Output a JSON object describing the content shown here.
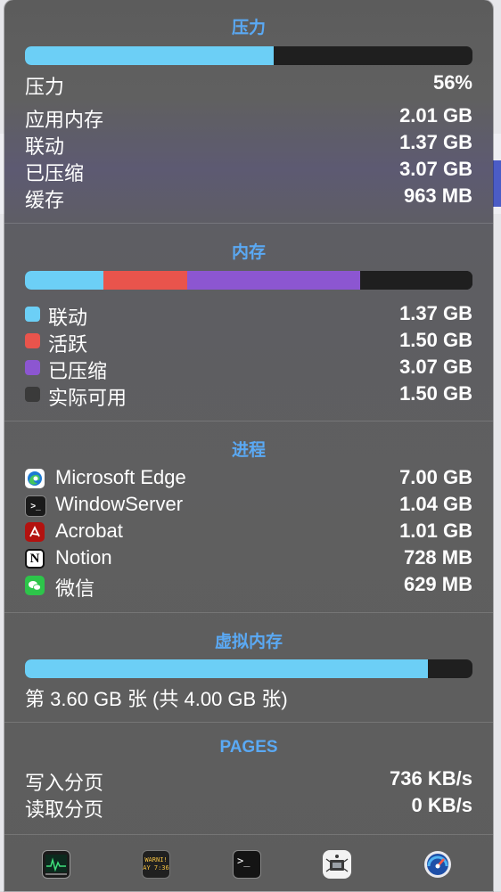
{
  "pressure": {
    "title": "压力",
    "bar_fill": 0.555,
    "bar_color": "#6ccff6",
    "label": "压力",
    "percent": "56%",
    "rows": [
      {
        "label": "应用内存",
        "value": "2.01 GB"
      },
      {
        "label": "联动",
        "value": "1.37 GB"
      },
      {
        "label": "已压缩",
        "value": "3.07 GB"
      },
      {
        "label": "缓存",
        "value": "963 MB"
      }
    ]
  },
  "memory": {
    "title": "内存",
    "segments": [
      {
        "fraction": 0.175,
        "color": "#6ccff6"
      },
      {
        "fraction": 0.187,
        "color": "#e9544c"
      },
      {
        "fraction": 0.388,
        "color": "#8c56d1"
      },
      {
        "fraction": 0.25,
        "color": "#1f1f1f"
      }
    ],
    "legend": [
      {
        "label": "联动",
        "value": "1.37 GB",
        "color": "#6ccff6"
      },
      {
        "label": "活跃",
        "value": "1.50 GB",
        "color": "#e9544c"
      },
      {
        "label": "已压缩",
        "value": "3.07 GB",
        "color": "#8c56d1"
      },
      {
        "label": "实际可用",
        "value": "1.50 GB",
        "color": "#3a3a3a"
      }
    ]
  },
  "processes": {
    "title": "进程",
    "items": [
      {
        "name": "Microsoft Edge",
        "value": "7.00 GB",
        "icon": "edge-icon"
      },
      {
        "name": "WindowServer",
        "value": "1.04 GB",
        "icon": "terminal-icon"
      },
      {
        "name": "Acrobat",
        "value": "1.01 GB",
        "icon": "acrobat-icon"
      },
      {
        "name": "Notion",
        "value": "728 MB",
        "icon": "notion-icon"
      },
      {
        "name": "微信",
        "value": "629 MB",
        "icon": "wechat-icon"
      }
    ]
  },
  "virtual_memory": {
    "title": "虚拟内存",
    "bar_fill": 0.9,
    "bar_color": "#6ccff6",
    "text": "第 3.60 GB 张 (共 4.00 GB 张)"
  },
  "pages": {
    "title": "PAGES",
    "rows": [
      {
        "label": "写入分页",
        "value": "736 KB/s"
      },
      {
        "label": "读取分页",
        "value": "0 KB/s"
      }
    ]
  },
  "dock": {
    "items": [
      {
        "icon": "activity-monitor-icon"
      },
      {
        "icon": "console-icon",
        "text_line1": "WARNI!",
        "text_line2": "AY 7:36"
      },
      {
        "icon": "terminal-app-icon"
      },
      {
        "icon": "system-information-icon"
      },
      {
        "icon": "disk-utility-gauge-icon"
      }
    ]
  }
}
